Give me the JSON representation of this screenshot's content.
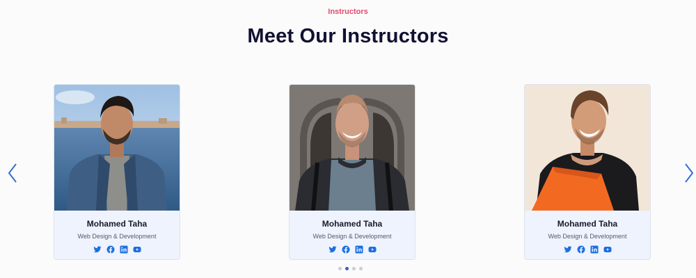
{
  "section": {
    "eyebrow": "Instructors",
    "title": "Meet Our Instructors"
  },
  "carousel": {
    "prev_icon": "chevron-left-icon",
    "next_icon": "chevron-right-icon",
    "dots_count": 4,
    "active_dot": 1
  },
  "instructors": [
    {
      "name": "Mohamed Taha",
      "role": "Web Design & Development",
      "socials": [
        "twitter",
        "facebook",
        "linkedin",
        "youtube"
      ]
    },
    {
      "name": "Mohamed Taha",
      "role": "Web Design & Development",
      "socials": [
        "twitter",
        "facebook",
        "linkedin",
        "youtube"
      ]
    },
    {
      "name": "Mohamed Taha",
      "role": "Web Design & Development",
      "socials": [
        "twitter",
        "facebook",
        "linkedin",
        "youtube"
      ]
    }
  ],
  "colors": {
    "accent": "#e5486c",
    "heading": "#111133",
    "social": "#1d6fe0",
    "arrow": "#2f6fd8",
    "card_bg": "#eef3fd"
  }
}
